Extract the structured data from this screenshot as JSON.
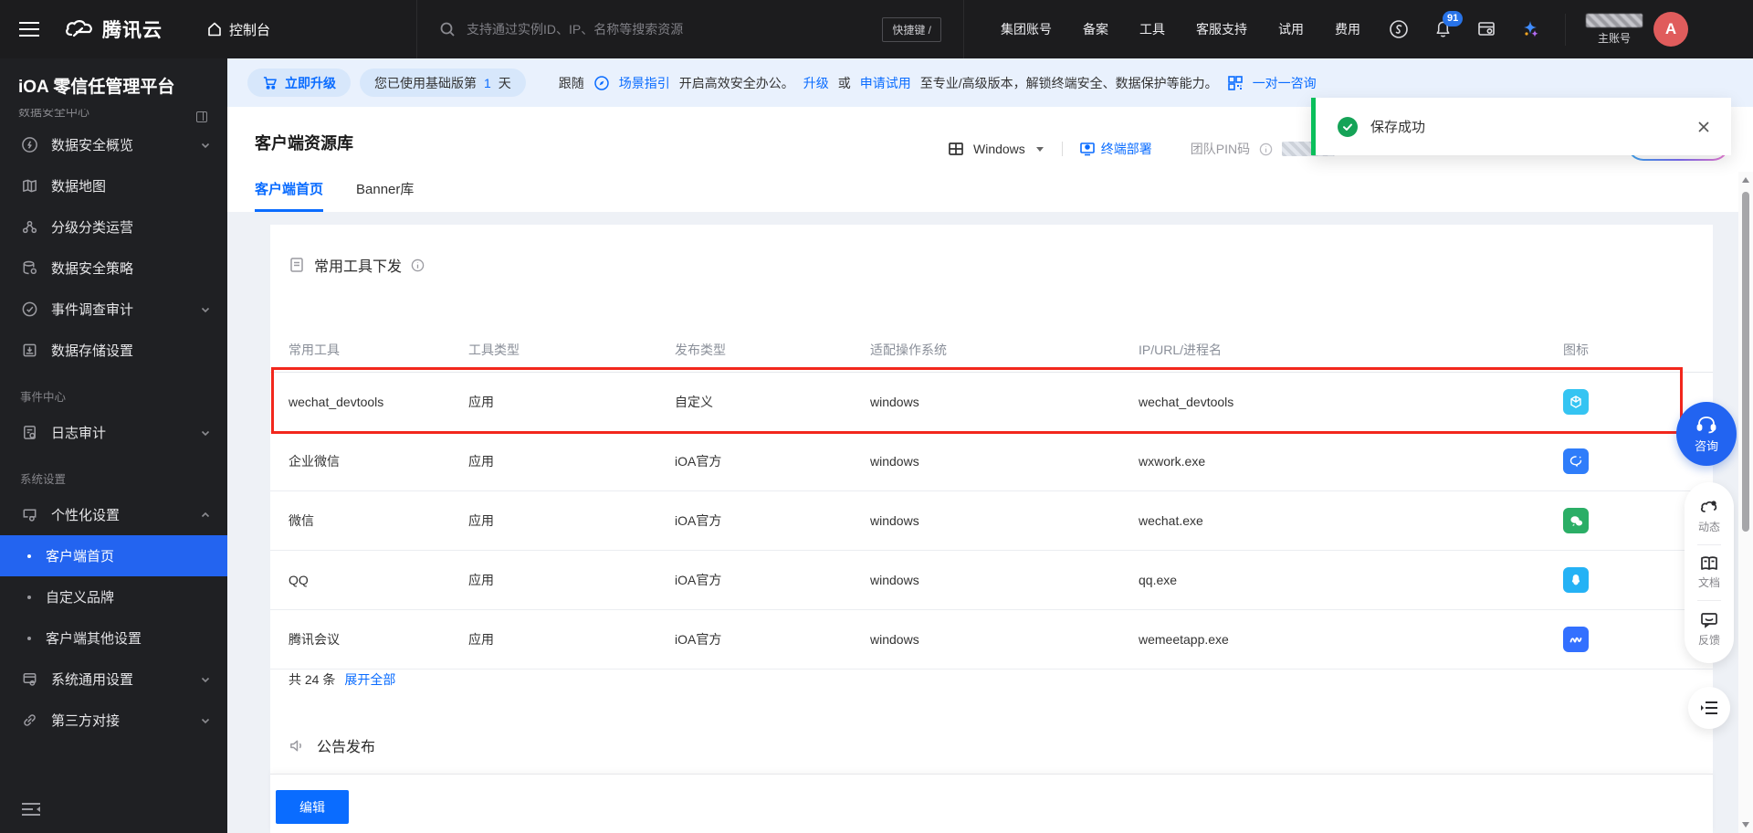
{
  "colors": {
    "accent": "#0a6cff",
    "sidebar_selected": "#2364f0",
    "toast_green": "#0abf5b",
    "annotation_red": "#f2271c",
    "badge_blue": "#2873e8",
    "avatar_red": "#e05c5c"
  },
  "topbar": {
    "brand": "腾讯云",
    "console": "控制台",
    "search_placeholder": "支持通过实例ID、IP、名称等搜索资源",
    "shortcut": "快捷键 /",
    "links": [
      {
        "label": "集团账号"
      },
      {
        "label": "备案"
      },
      {
        "label": "工具"
      },
      {
        "label": "客服支持"
      },
      {
        "label": "试用"
      },
      {
        "label": "费用"
      }
    ],
    "bell_badge": "91",
    "account_label": "主账号",
    "avatar_initial": "A"
  },
  "sidebar": {
    "title": "iOA 零信任管理平台",
    "clipped_section": "数据安全中心",
    "items": [
      {
        "label": "数据安全概览"
      },
      {
        "label": "数据地图"
      },
      {
        "label": "分级分类运营"
      },
      {
        "label": "数据安全策略"
      },
      {
        "label": "事件调查审计"
      },
      {
        "label": "数据存储设置"
      }
    ],
    "section_event": "事件中心",
    "log_audit": "日志审计",
    "section_system": "系统设置",
    "personalize": "个性化设置",
    "subitems": [
      {
        "label": "客户端首页",
        "selected": true
      },
      {
        "label": "自定义品牌"
      },
      {
        "label": "客户端其他设置"
      }
    ],
    "system_general": "系统通用设置",
    "third_party": "第三方对接"
  },
  "banner": {
    "upgrade_button": "立即升级",
    "usage_prefix": "您已使用基础版第",
    "usage_value": "1",
    "usage_unit": "天",
    "follow": "跟随",
    "guide_link": "场景指引",
    "text1": "开启高效安全办公。",
    "upgrade_link": "升级",
    "or": "或",
    "trial_link": "申请试用",
    "text2": "至专业/高级版本，解锁终端安全、数据保护等能力。",
    "consult_link": "一对一咨询"
  },
  "page": {
    "title": "客户端资源库",
    "tabs": [
      {
        "label": "客户端首页"
      },
      {
        "label": "Banner库"
      }
    ],
    "os_selector": "Windows",
    "deploy_link": "终端部署",
    "pin_label": "团队PIN码"
  },
  "toast": {
    "message": "保存成功"
  },
  "tools_section": {
    "title": "常用工具下发",
    "headers": [
      {
        "label": "常用工具"
      },
      {
        "label": "工具类型"
      },
      {
        "label": "发布类型"
      },
      {
        "label": "适配操作系统"
      },
      {
        "label": "IP/URL/进程名"
      },
      {
        "label": "图标"
      }
    ],
    "rows": [
      {
        "name": "wechat_devtools",
        "type": "应用",
        "publish": "自定义",
        "os": "windows",
        "process": "wechat_devtools",
        "icon": "wechat-devtools-icon",
        "icon_color": "#35c4f2",
        "highlighted": true
      },
      {
        "name": "企业微信",
        "type": "应用",
        "publish": "iOA官方",
        "os": "windows",
        "process": "wxwork.exe",
        "icon": "wecom-icon",
        "icon_color": "#2f7dfa"
      },
      {
        "name": "微信",
        "type": "应用",
        "publish": "iOA官方",
        "os": "windows",
        "process": "wechat.exe",
        "icon": "wechat-icon",
        "icon_color": "#2bae66"
      },
      {
        "name": "QQ",
        "type": "应用",
        "publish": "iOA官方",
        "os": "windows",
        "process": "qq.exe",
        "icon": "qq-icon",
        "icon_color": "#25b2f5"
      },
      {
        "name": "腾讯会议",
        "type": "应用",
        "publish": "iOA官方",
        "os": "windows",
        "process": "wemeetapp.exe",
        "icon": "tencent-meeting-icon",
        "icon_color": "#3370ff"
      }
    ],
    "total_text": "共 24 条",
    "expand_link": "展开全部"
  },
  "announce_section": {
    "title": "公告发布"
  },
  "footer": {
    "edit_button": "编辑"
  },
  "floating": {
    "consult": "咨询",
    "news": "动态",
    "docs": "文档",
    "feedback": "反馈"
  }
}
